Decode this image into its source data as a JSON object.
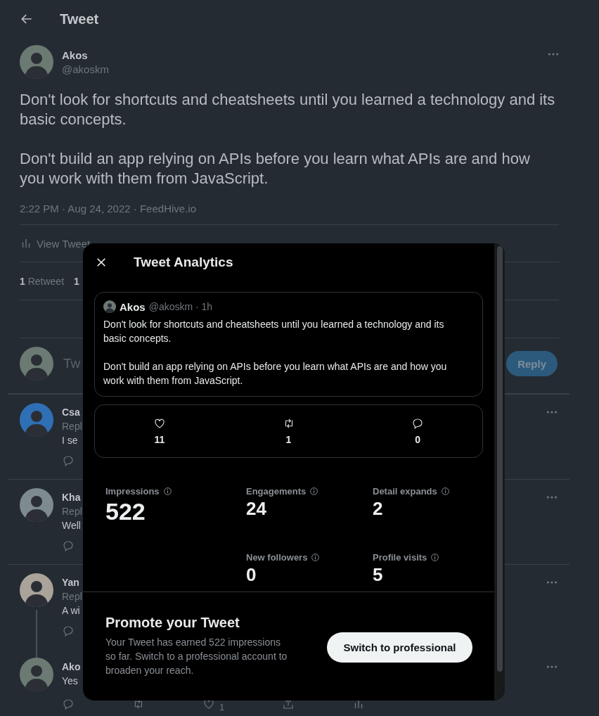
{
  "header": {
    "title": "Tweet"
  },
  "tweet": {
    "author": "Akos",
    "handle": "@akoskm",
    "paragraphs": [
      "Don't look for shortcuts and cheatsheets until you learned a technology and its basic concepts.",
      "Don't build an app relying on APIs before you learn what APIs are and how you work with them from JavaScript."
    ],
    "meta": "2:22 PM · Aug 24, 2022 · FeedHive.io",
    "analytics_link": "View Tweet",
    "stats": [
      {
        "count": "1",
        "label": "Retweet"
      },
      {
        "count": "1"
      }
    ]
  },
  "composer": {
    "placeholder": "Tw",
    "button": "Reply"
  },
  "replies": [
    {
      "name": "Csa",
      "replying": "Repl",
      "text": "I se",
      "thread_connector": false
    },
    {
      "name": "Kha",
      "replying": "Repl",
      "text": "Well",
      "thread_connector": false
    },
    {
      "name": "Yan",
      "replying": "Repl",
      "text": "A wi",
      "thread_connector": true
    },
    {
      "name": "Ako",
      "text": "Yes",
      "thread_connector": false,
      "like_count": "1"
    }
  ],
  "modal": {
    "title": "Tweet Analytics",
    "quote": {
      "author": "Akos",
      "meta": "@akoskm · 1h",
      "paragraphs": [
        "Don't look for shortcuts and cheatsheets until you learned a technology and its basic concepts.",
        "Don't build an app relying on APIs before you learn what APIs are and how you work with them from JavaScript."
      ]
    },
    "engagement": [
      {
        "kind": "like",
        "count": "11"
      },
      {
        "kind": "retweet",
        "count": "1"
      },
      {
        "kind": "reply",
        "count": "0"
      }
    ],
    "metrics": [
      {
        "label": "Impressions",
        "value": "522",
        "primary": true
      },
      {
        "label": "Engagements",
        "value": "24",
        "primary": false
      },
      {
        "label": "Detail expands",
        "value": "2",
        "primary": false
      },
      {
        "label": "New followers",
        "value": "0",
        "primary": false
      },
      {
        "label": "Profile visits",
        "value": "5",
        "primary": false
      }
    ],
    "promote": {
      "title": "Promote your Tweet",
      "text": "Your Tweet has earned 522 impressions so far. Switch to a professional account to broaden your reach.",
      "button": "Switch to professional"
    }
  }
}
